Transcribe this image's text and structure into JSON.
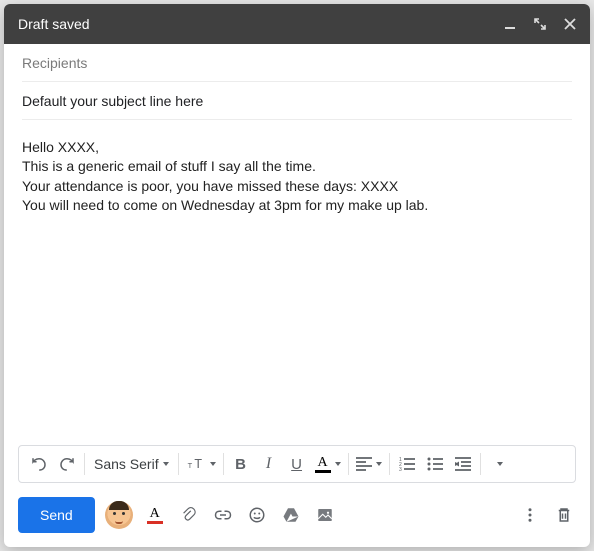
{
  "header": {
    "title": "Draft saved"
  },
  "fields": {
    "recipients_placeholder": "Recipients",
    "recipients_value": "",
    "subject": "Default your subject line here"
  },
  "body": {
    "text": "Hello XXXX,\nThis is a generic email of stuff I say all the time.\nYour attendance is poor, you have missed these days: XXXX\nYou will need to come on Wednesday at 3pm for my make up lab."
  },
  "format_toolbar": {
    "font_family": "Sans Serif",
    "bold": "B",
    "italic": "I",
    "underline": "U"
  },
  "bottom_bar": {
    "send_label": "Send"
  },
  "icons": {
    "minimize": "minimize",
    "fullscreen": "fullscreen",
    "close": "close",
    "undo": "undo",
    "redo": "redo",
    "font_size": "font-size",
    "text_color": "text-color",
    "align": "align",
    "list_numbered": "list-numbered",
    "list_bulleted": "list-bulleted",
    "indent_less": "indent-less",
    "avatar": "avatar",
    "attachment": "attachment",
    "link": "link",
    "emoji": "emoji",
    "drive": "drive",
    "image": "image",
    "more_vert": "more-vert",
    "delete": "delete"
  }
}
